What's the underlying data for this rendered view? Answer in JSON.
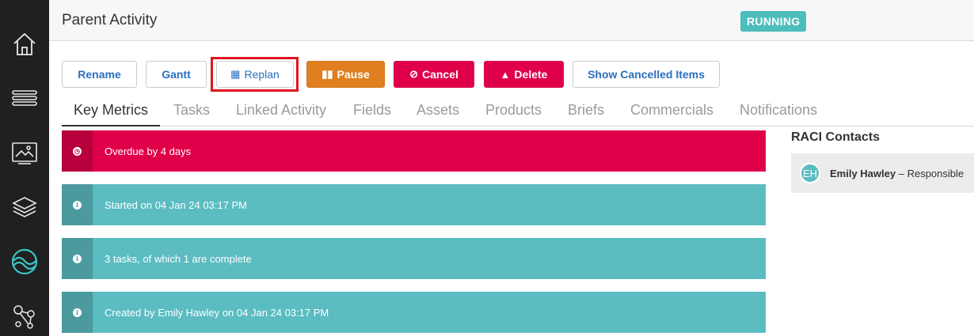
{
  "sidebar": {
    "items": [
      {
        "icon": "home-icon"
      },
      {
        "icon": "list-icon"
      },
      {
        "icon": "image-gallery-icon"
      },
      {
        "icon": "layers-icon"
      },
      {
        "icon": "brand-wave-icon"
      },
      {
        "icon": "network-nodes-icon"
      }
    ]
  },
  "header": {
    "title": "Parent Activity",
    "status": "RUNNING"
  },
  "toolbar": {
    "rename": "Rename",
    "gantt": "Gantt",
    "replan": "Replan",
    "pause": "Pause",
    "cancel": "Cancel",
    "delete": "Delete",
    "show_cancelled": "Show Cancelled Items"
  },
  "tabs": [
    {
      "label": "Key Metrics",
      "active": true
    },
    {
      "label": "Tasks"
    },
    {
      "label": "Linked Activity"
    },
    {
      "label": "Fields"
    },
    {
      "label": "Assets"
    },
    {
      "label": "Products"
    },
    {
      "label": "Briefs"
    },
    {
      "label": "Commercials"
    },
    {
      "label": "Notifications"
    }
  ],
  "metrics": [
    {
      "text": "Overdue by 4 days",
      "type": "danger",
      "icon": "clock-icon"
    },
    {
      "text": "Started on 04 Jan 24 03:17 PM",
      "type": "info",
      "icon": "info-icon"
    },
    {
      "text": "3 tasks, of which 1 are complete",
      "type": "info",
      "icon": "info-icon"
    },
    {
      "text": "Created by Emily Hawley on 04 Jan 24 03:17 PM",
      "type": "info",
      "icon": "info-icon"
    }
  ],
  "raci": {
    "title": "RACI Contacts",
    "contacts": [
      {
        "initials": "EH",
        "name": "Emily Hawley",
        "role": "– Responsible"
      }
    ]
  },
  "colors": {
    "accent_teal": "#5bbcc1",
    "danger": "#e0004a",
    "warning": "#e07f1f",
    "link_blue": "#2a6fc0"
  }
}
